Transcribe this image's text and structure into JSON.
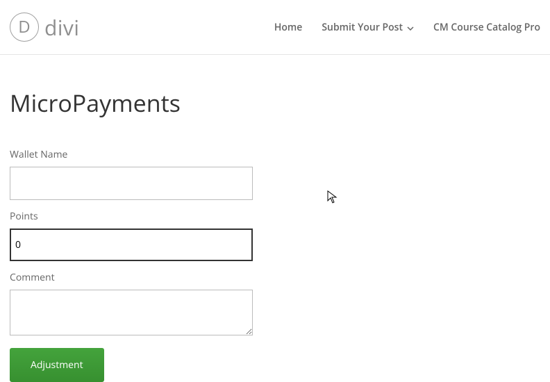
{
  "logo": {
    "letter": "D",
    "text": "divi"
  },
  "nav": {
    "home": "Home",
    "submit": "Submit Your Post",
    "catalog": "CM Course Catalog Pro"
  },
  "page": {
    "title": "MicroPayments"
  },
  "form": {
    "wallet_label": "Wallet Name",
    "wallet_value": "",
    "points_label": "Points",
    "points_value": "0",
    "comment_label": "Comment",
    "comment_value": "",
    "button_label": "Adjustment"
  }
}
